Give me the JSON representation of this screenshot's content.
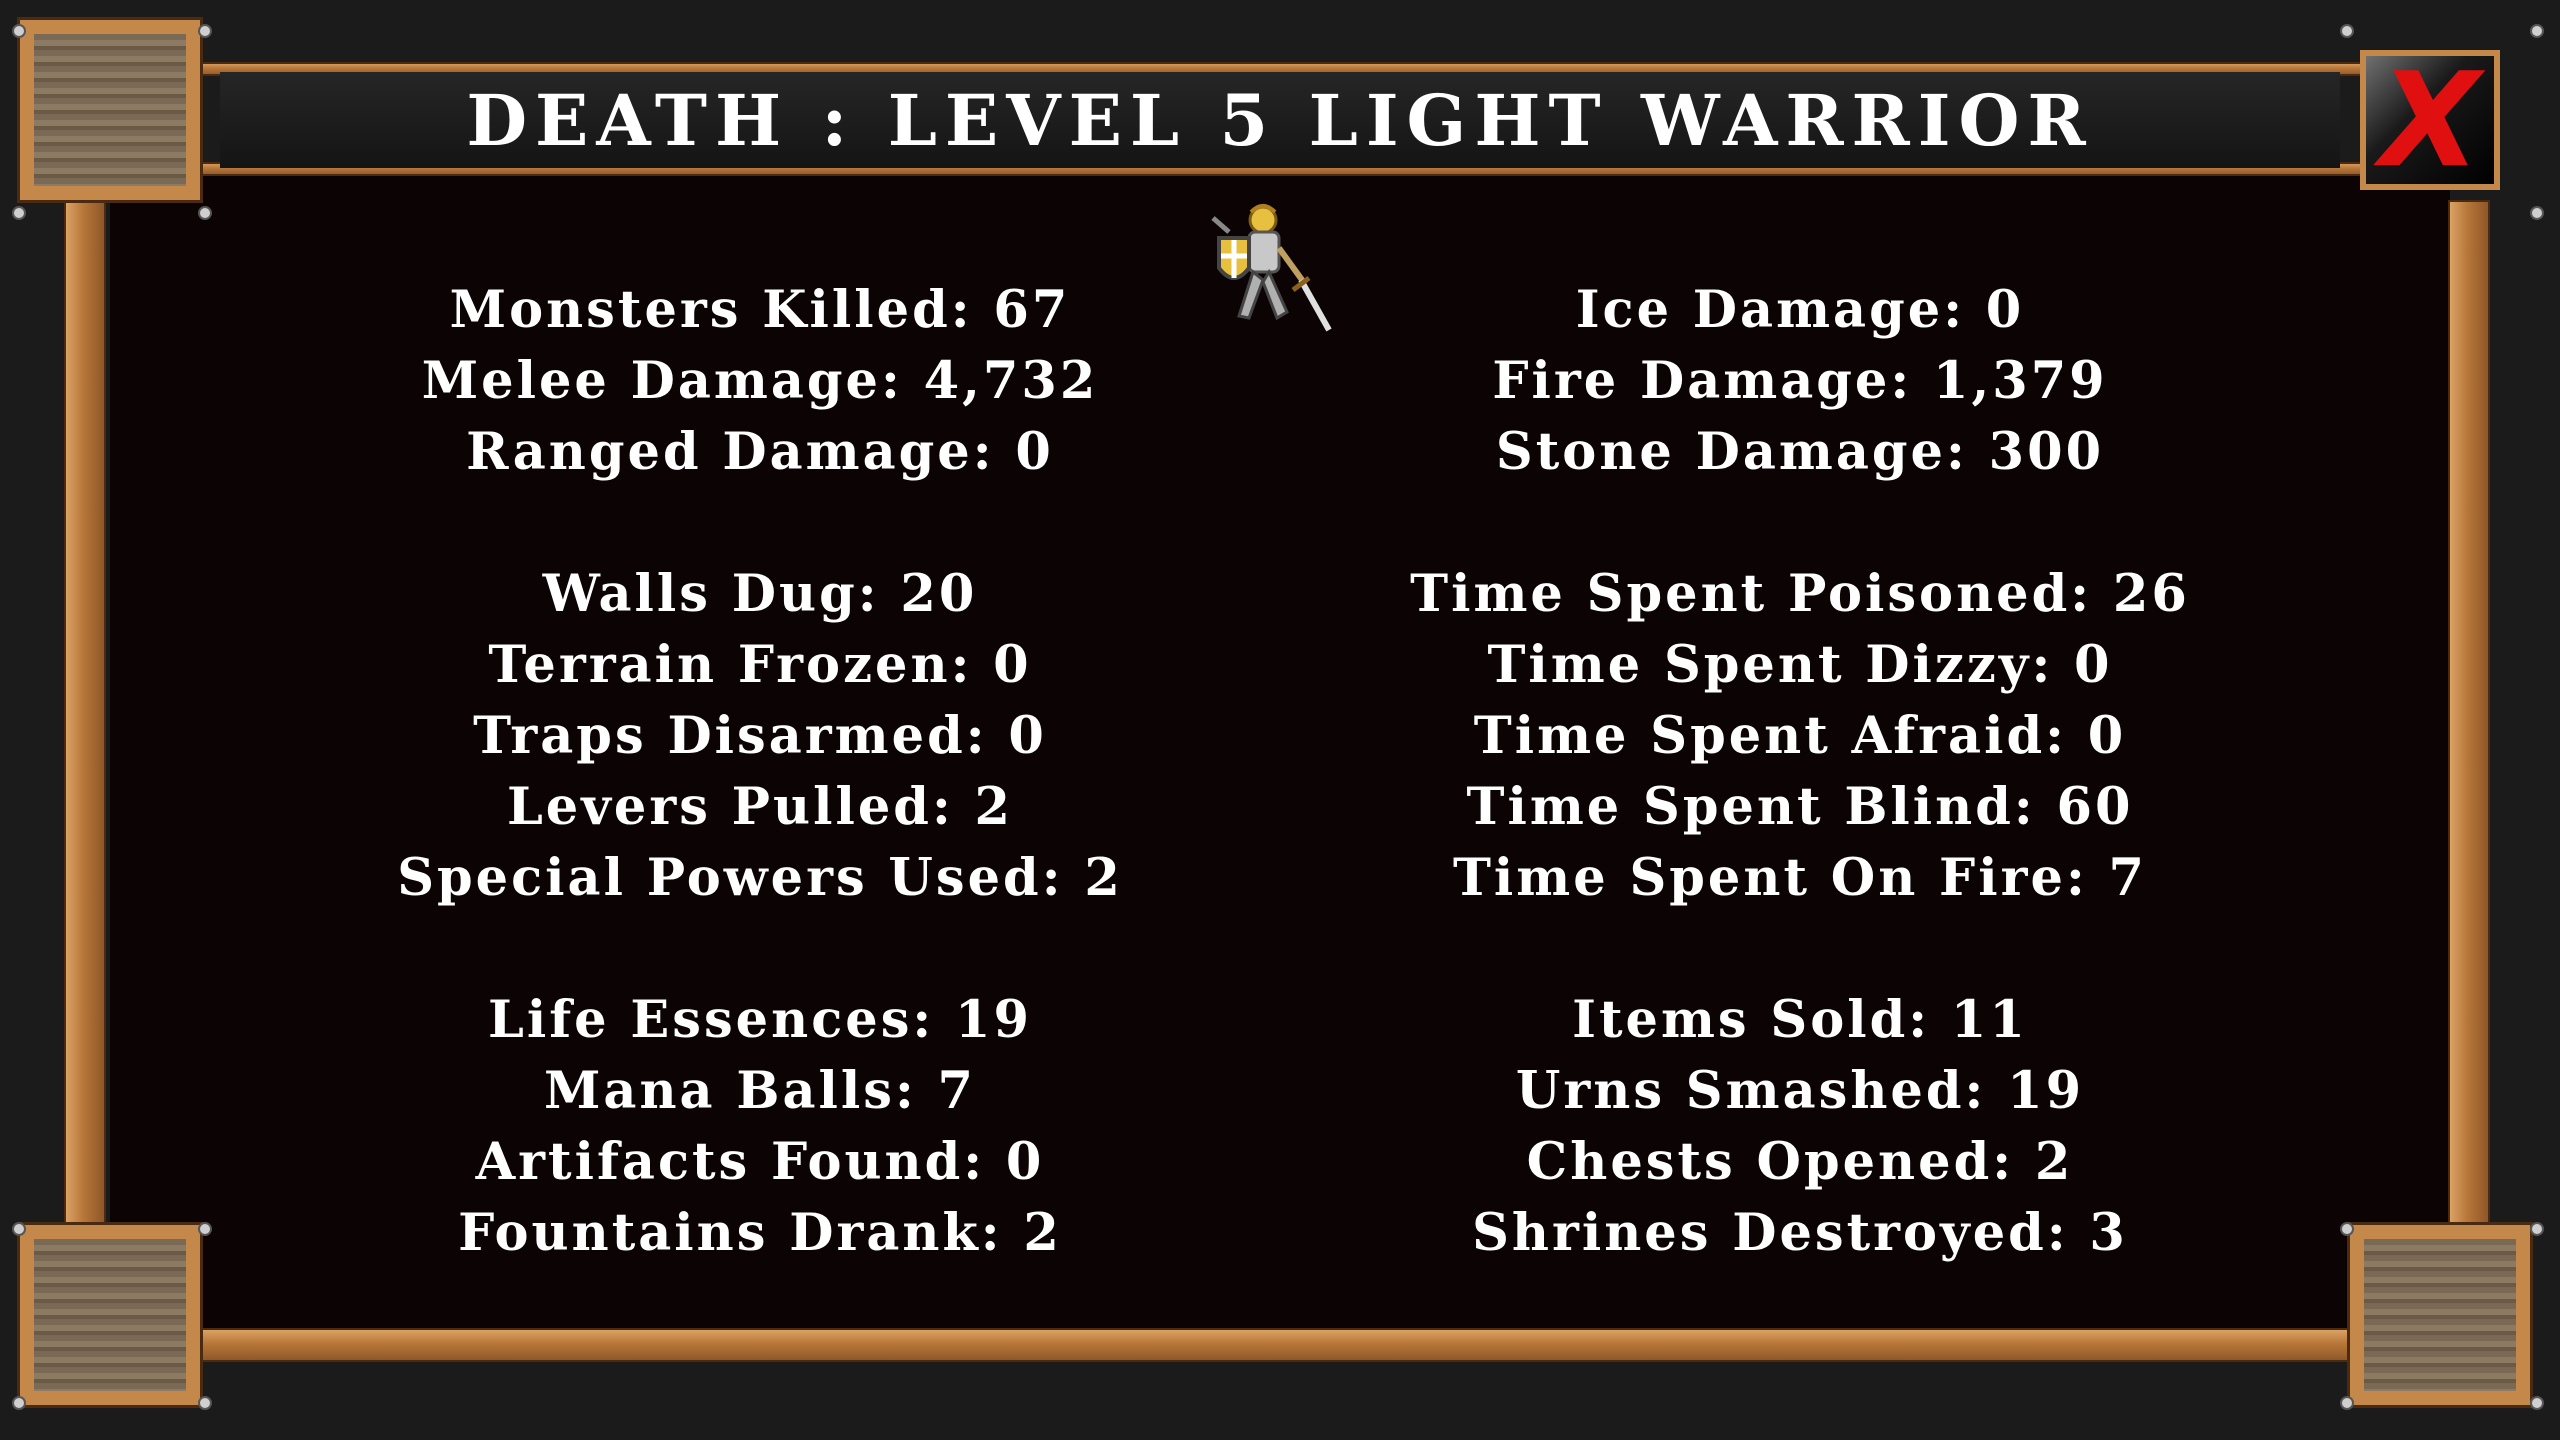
{
  "title": "DEATH : LEVEL 5 LIGHT WARRIOR",
  "close_button": {
    "icon": "close-x-icon",
    "label": "X",
    "color": "#e01010"
  },
  "character_sprite": {
    "icon": "warrior-sprite-icon"
  },
  "left_column": [
    [
      {
        "label": "Monsters Killed",
        "value": "67"
      },
      {
        "label": "Melee Damage",
        "value": "4,732"
      },
      {
        "label": "Ranged Damage",
        "value": "0"
      }
    ],
    [
      {
        "label": "Walls Dug",
        "value": "20"
      },
      {
        "label": "Terrain Frozen",
        "value": "0"
      },
      {
        "label": "Traps Disarmed",
        "value": "0"
      },
      {
        "label": "Levers Pulled",
        "value": "2"
      },
      {
        "label": "Special Powers Used",
        "value": "2"
      }
    ],
    [
      {
        "label": "Life Essences",
        "value": "19"
      },
      {
        "label": "Mana Balls",
        "value": "7"
      },
      {
        "label": "Artifacts Found",
        "value": "0"
      },
      {
        "label": "Fountains Drank",
        "value": "2"
      }
    ]
  ],
  "right_column": [
    [
      {
        "label": "Ice Damage",
        "value": "0"
      },
      {
        "label": "Fire Damage",
        "value": "1,379"
      },
      {
        "label": "Stone Damage",
        "value": "300"
      }
    ],
    [
      {
        "label": "Time Spent Poisoned",
        "value": "26"
      },
      {
        "label": "Time Spent Dizzy",
        "value": "0"
      },
      {
        "label": "Time Spent Afraid",
        "value": "0"
      },
      {
        "label": "Time Spent Blind",
        "value": "60"
      },
      {
        "label": "Time Spent On Fire",
        "value": "7"
      }
    ],
    [
      {
        "label": "Items Sold",
        "value": "11"
      },
      {
        "label": "Urns Smashed",
        "value": "19"
      },
      {
        "label": "Chests Opened",
        "value": "2"
      },
      {
        "label": "Shrines Destroyed",
        "value": "3"
      }
    ]
  ]
}
